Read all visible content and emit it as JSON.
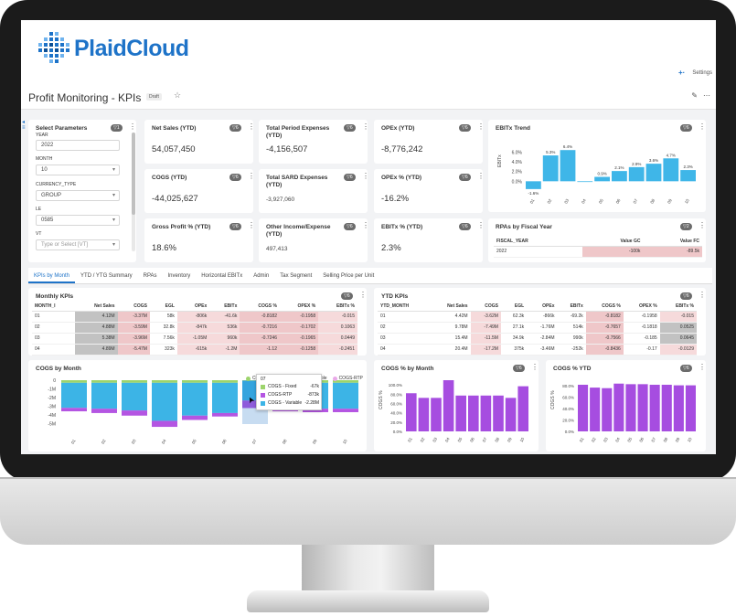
{
  "app": {
    "name": "PlaidCloud",
    "header_links": [
      "Settings"
    ]
  },
  "page": {
    "title": "Profit Monitoring - KPIs",
    "badge": "Draft"
  },
  "params": {
    "title": "Select Parameters",
    "filter_badge": "1",
    "fields": [
      {
        "label": "YEAR",
        "value": "2022",
        "type": "text"
      },
      {
        "label": "MONTH",
        "value": "10",
        "type": "select"
      },
      {
        "label": "CURRENCY_TYPE",
        "value": "GROUP",
        "type": "select"
      },
      {
        "label": "LE",
        "value": "0585",
        "type": "select"
      },
      {
        "label": "VT",
        "value": "",
        "placeholder": "Type or Select [VT]",
        "type": "select"
      }
    ]
  },
  "kpis": [
    {
      "title": "Net Sales (YTD)",
      "value": "54,057,450",
      "badge": "6"
    },
    {
      "title": "Total Period Expenses (YTD)",
      "value": "-4,156,507",
      "badge": "6"
    },
    {
      "title": "OPEx (YTD)",
      "value": "-8,776,242",
      "badge": "6"
    },
    {
      "title": "COGS (YTD)",
      "value": "-44,025,627",
      "badge": "6"
    },
    {
      "title": "Total SARD Expenses (YTD)",
      "value": "-3,927,060",
      "badge": "6"
    },
    {
      "title": "OPEx % (YTD)",
      "value": "-16.2%",
      "badge": "6"
    },
    {
      "title": "Gross Profit % (YTD)",
      "value": "18.6%",
      "badge": "6"
    },
    {
      "title": "Other Income/Expense (YTD)",
      "value": "497,413",
      "badge": "6"
    },
    {
      "title": "EBITx % (YTD)",
      "value": "2.3%",
      "badge": "6"
    }
  ],
  "ebitx_trend": {
    "title": "EBITx Trend",
    "badge": "6"
  },
  "rpa": {
    "title": "RPAs by Fiscal Year",
    "badge": "2",
    "columns": [
      "FISCAL_YEAR",
      "Value GC",
      "Value FC"
    ],
    "rows": [
      [
        "2022",
        "-100k",
        "-89.5k"
      ]
    ]
  },
  "tabs": [
    "KPIs by Month",
    "YTD / YTG Summary",
    "RPAs",
    "Inventory",
    "Horizontal EBITx",
    "Admin",
    "Tax Segment",
    "Selling Price per Unit"
  ],
  "monthly_kpis": {
    "title": "Monthly KPIs",
    "badge": "6",
    "columns": [
      "MONTH_I",
      "Net Sales",
      "COGS",
      "EGL",
      "OPEx",
      "EBITx",
      "COGS %",
      "OPEX %",
      "EBITx %"
    ],
    "rows": [
      [
        "01",
        "4.12M",
        "-3.37M",
        "58k",
        "-806k",
        "-41.6k",
        "-0.8182",
        "-0.1958",
        "-0.015"
      ],
      [
        "02",
        "4.88M",
        "-3.59M",
        "32.8k",
        "-847k",
        "536k",
        "-0.7216",
        "-0.1702",
        "0.1063"
      ],
      [
        "03",
        "5.38M",
        "-3.96M",
        "7.56k",
        "-1.05M",
        "960k",
        "-0.7246",
        "-0.1965",
        "0.0449"
      ],
      [
        "04",
        "4.89M",
        "-5.47M",
        "323k",
        "-615k",
        "-1.2M",
        "-1.12",
        "-0.1258",
        "-0.2451"
      ]
    ]
  },
  "ytd_kpis": {
    "title": "YTD KPIs",
    "badge": "6",
    "columns": [
      "YTD_MONTH",
      "Net Sales",
      "COGS",
      "EGL",
      "OPEx",
      "EBITx",
      "COGS %",
      "OPEX %",
      "EBITx %"
    ],
    "rows": [
      [
        "01",
        "4.42M",
        "-3.62M",
        "62.3k",
        "-866k",
        "-69.2k",
        "-0.8182",
        "-0.1958",
        "-0.015"
      ],
      [
        "02",
        "9.78M",
        "-7.49M",
        "27.1k",
        "-1.76M",
        "514k",
        "-0.7657",
        "-0.1818",
        "0.0525"
      ],
      [
        "03",
        "15.4M",
        "-11.5M",
        "34.9k",
        "-2.84M",
        "990k",
        "-0.7566",
        "-0.185",
        "0.0645"
      ],
      [
        "04",
        "20.4M",
        "-17.2M",
        "375k",
        "-3.46M",
        "-252k",
        "-0.8436",
        "-0.17",
        "-0.0129"
      ]
    ]
  },
  "cogs_month": {
    "title": "COGS by Month",
    "legend": [
      "COGS - Fixed",
      "COGS - Variable",
      "COGS-RTP"
    ],
    "tooltip": {
      "header": "07",
      "rows": [
        {
          "label": "COGS - Fixed",
          "value": "-67k",
          "color": "#9dd46c"
        },
        {
          "label": "COGS-RTP",
          "value": "-873k",
          "color": "#b455e2"
        },
        {
          "label": "COGS - Variable",
          "value": "-2.28M",
          "color": "#3cb4e6"
        }
      ]
    }
  },
  "cogs_pct_month": {
    "title": "COGS % by Month",
    "badge": "6"
  },
  "cogs_pct_ytd": {
    "title": "COGS % YTD",
    "badge": "6"
  },
  "chart_data": [
    {
      "type": "bar",
      "title": "EBITx Trend",
      "categories": [
        "01",
        "02",
        "03",
        "04",
        "05",
        "06",
        "07",
        "08",
        "09",
        "10"
      ],
      "values": [
        -1.6,
        5.3,
        6.4,
        0,
        0.9,
        2.1,
        2.9,
        3.6,
        4.7,
        2.3
      ],
      "data_labels": [
        "-1.6%",
        "5.3%",
        "6.4%",
        "",
        "0.9%",
        "2.1%",
        "2.9%",
        "3.6%",
        "4.7%",
        "2.3%"
      ],
      "ylabel": "EBITx",
      "y_ticks": [
        "0.0%",
        "2.0%",
        "4.0%",
        "6.0%"
      ],
      "ylim": [
        -2,
        7
      ]
    },
    {
      "type": "bar",
      "title": "COGS by Month",
      "stacked": true,
      "categories": [
        "01",
        "02",
        "03",
        "04",
        "05",
        "06",
        "07",
        "08",
        "09",
        "10"
      ],
      "y_ticks": [
        "0",
        "-1M",
        "-2M",
        "-3M",
        "-4M",
        "-5M"
      ],
      "ylim": [
        -5.5,
        0
      ],
      "series": [
        {
          "name": "COGS - Fixed",
          "color": "#9dd46c",
          "values": [
            -0.3,
            -0.3,
            -0.3,
            -0.3,
            -0.3,
            -0.3,
            -0.07,
            -0.3,
            -0.3,
            -0.3
          ]
        },
        {
          "name": "COGS - Variable",
          "color": "#3cb4e6",
          "values": [
            -2.9,
            -3.0,
            -3.2,
            -4.4,
            -3.8,
            -3.5,
            -2.28,
            -2.9,
            -3.0,
            -3.0
          ]
        },
        {
          "name": "COGS-RTP",
          "color": "#b455e2",
          "values": [
            -0.4,
            -0.5,
            -0.6,
            -0.7,
            -0.5,
            -0.4,
            -0.873,
            -0.4,
            -0.4,
            -0.4
          ]
        }
      ]
    },
    {
      "type": "bar",
      "title": "COGS % by Month",
      "color": "#a64de0",
      "categories": [
        "01",
        "02",
        "03",
        "04",
        "05",
        "06",
        "07",
        "08",
        "09",
        "10"
      ],
      "values": [
        82,
        72,
        72,
        110,
        77,
        77,
        77,
        77,
        72,
        97
      ],
      "ylabel": "COGS %",
      "y_ticks": [
        "0.0%",
        "20.0%",
        "40.0%",
        "60.0%",
        "80.0%",
        "100.0%"
      ],
      "ylim": [
        0,
        110
      ]
    },
    {
      "type": "bar",
      "title": "COGS % YTD",
      "color": "#a64de0",
      "categories": [
        "01",
        "02",
        "03",
        "04",
        "05",
        "06",
        "07",
        "08",
        "09",
        "10"
      ],
      "values": [
        82,
        77,
        76,
        84,
        83,
        83,
        82,
        82,
        81,
        81
      ],
      "ylabel": "COGS %",
      "y_ticks": [
        "0.0%",
        "20.0%",
        "40.0%",
        "60.0%",
        "80.0%"
      ],
      "ylim": [
        0,
        90
      ]
    }
  ]
}
